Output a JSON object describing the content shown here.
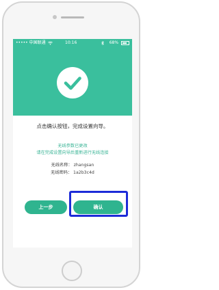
{
  "status_bar": {
    "carrier": "••••• 中国联通",
    "wifi_icon": "wifi-icon",
    "time": "10:16",
    "bluetooth_icon": "bluetooth-icon",
    "battery_percent": "68%",
    "battery_level": 0.68
  },
  "header": {
    "icon": "check-circle-icon",
    "accent_color": "#3abf9d"
  },
  "content": {
    "message": "点击确认按钮，完成设置向导。",
    "note_line1": "无线参数已更改",
    "note_line2": "请在完成设置向导后重新进行无线连接",
    "ssid_label": "无线名称：",
    "ssid_value": "zhangsan",
    "password_label": "无线密码：",
    "password_value": "1a2b3c4d"
  },
  "buttons": {
    "back_label": "上一步",
    "confirm_label": "确认"
  },
  "highlight_color": "#1c2bd8"
}
